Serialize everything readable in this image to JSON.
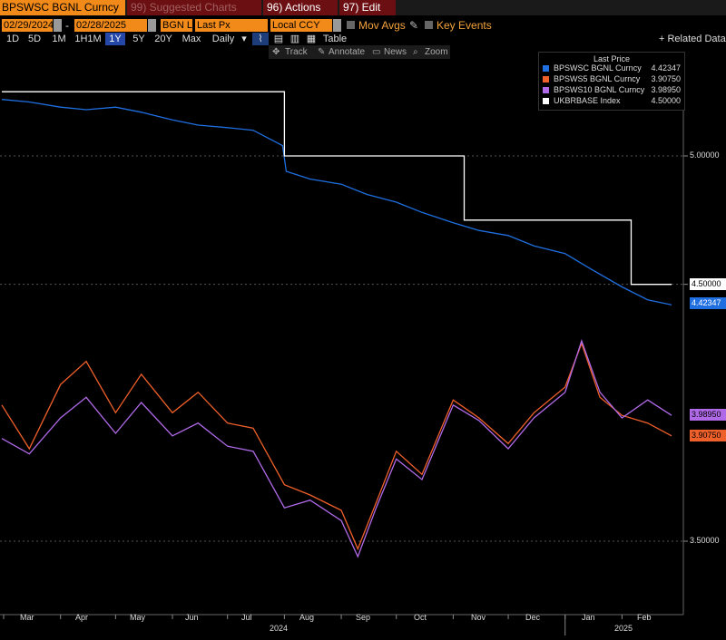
{
  "toolbar": {
    "ticker": "BPSWSC BGNL Curncy",
    "suggested_charts": "99) Suggested Charts",
    "actions": "96) Actions",
    "edit": "97) Edit",
    "date_from": "02/29/2024",
    "date_to": "02/28/2025",
    "source": "BGN L",
    "price_field": "Last Px",
    "currency": "Local CCY",
    "mov_avgs": "Mov Avgs",
    "key_events": "Key Events",
    "periods": [
      "1D",
      "5D",
      "1M",
      "1H1M",
      "1Y",
      "5Y",
      "20Y",
      "Max"
    ],
    "selected_period": "1Y",
    "frequency": "Daily",
    "table": "Table",
    "related": "+ Related Data",
    "track": "Track",
    "annotate": "Annotate",
    "news": "News",
    "zoom": "Zoom"
  },
  "chart_data": {
    "type": "line",
    "yticks": [
      "5.00000",
      "4.50000",
      "3.50000"
    ],
    "xticks": [
      "Mar",
      "Apr",
      "May",
      "Jun",
      "Jul",
      "Aug",
      "Sep",
      "Oct",
      "Nov",
      "Dec",
      "Jan",
      "Feb"
    ],
    "year_labels": [
      "2024",
      "2025"
    ],
    "legend_title": "Last Price",
    "legend_position": "top-right",
    "series": [
      {
        "name": "BPSWSC BGNL Curncy",
        "last": "4.42347",
        "color": "#1f6fe0",
        "x": [
          "2024-02-29",
          "2024-03-15",
          "2024-04-01",
          "2024-04-15",
          "2024-05-01",
          "2024-05-15",
          "2024-06-01",
          "2024-06-15",
          "2024-07-01",
          "2024-07-15",
          "2024-07-31",
          "2024-08-02",
          "2024-08-15",
          "2024-09-01",
          "2024-09-15",
          "2024-10-01",
          "2024-10-15",
          "2024-11-01",
          "2024-11-15",
          "2024-12-01",
          "2024-12-15",
          "2025-01-01",
          "2025-01-15",
          "2025-02-01",
          "2025-02-15",
          "2025-02-28"
        ],
        "y": [
          5.22,
          5.21,
          5.19,
          5.18,
          5.19,
          5.17,
          5.14,
          5.12,
          5.11,
          5.1,
          5.04,
          4.94,
          4.91,
          4.89,
          4.85,
          4.82,
          4.78,
          4.74,
          4.71,
          4.69,
          4.65,
          4.62,
          4.56,
          4.49,
          4.44,
          4.42
        ]
      },
      {
        "name": "BPSWS5 BGNL Curncy",
        "last": "3.90750",
        "color": "#f0602a",
        "x": [
          "2024-02-29",
          "2024-03-15",
          "2024-04-01",
          "2024-04-15",
          "2024-05-01",
          "2024-05-15",
          "2024-06-01",
          "2024-06-15",
          "2024-07-01",
          "2024-07-15",
          "2024-08-01",
          "2024-08-15",
          "2024-09-01",
          "2024-09-10",
          "2024-09-20",
          "2024-10-01",
          "2024-10-15",
          "2024-11-01",
          "2024-11-15",
          "2024-12-01",
          "2024-12-15",
          "2025-01-01",
          "2025-01-10",
          "2025-01-20",
          "2025-02-01",
          "2025-02-15",
          "2025-02-28"
        ],
        "y": [
          4.03,
          3.86,
          4.11,
          4.2,
          4.0,
          4.15,
          4.0,
          4.08,
          3.96,
          3.94,
          3.72,
          3.68,
          3.62,
          3.47,
          3.65,
          3.85,
          3.76,
          4.05,
          3.98,
          3.88,
          4.0,
          4.1,
          4.27,
          4.06,
          3.99,
          3.96,
          3.91
        ]
      },
      {
        "name": "BPSWS10 BGNL Curncy",
        "last": "3.98950",
        "color": "#b06ae8",
        "x": [
          "2024-02-29",
          "2024-03-15",
          "2024-04-01",
          "2024-04-15",
          "2024-05-01",
          "2024-05-15",
          "2024-06-01",
          "2024-06-15",
          "2024-07-01",
          "2024-07-15",
          "2024-08-01",
          "2024-08-15",
          "2024-09-01",
          "2024-09-10",
          "2024-09-20",
          "2024-10-01",
          "2024-10-15",
          "2024-11-01",
          "2024-11-15",
          "2024-12-01",
          "2024-12-15",
          "2025-01-01",
          "2025-01-10",
          "2025-01-20",
          "2025-02-01",
          "2025-02-15",
          "2025-02-28"
        ],
        "y": [
          3.9,
          3.84,
          3.98,
          4.06,
          3.92,
          4.04,
          3.91,
          3.96,
          3.87,
          3.85,
          3.63,
          3.66,
          3.58,
          3.44,
          3.63,
          3.82,
          3.74,
          4.03,
          3.97,
          3.86,
          3.98,
          4.08,
          4.28,
          4.08,
          3.98,
          4.05,
          3.99
        ]
      },
      {
        "name": "UKBRBASE Index",
        "last": "4.50000",
        "color": "#ffffff",
        "x": [
          "2024-02-29",
          "2024-08-01",
          "2024-08-01",
          "2024-09-19",
          "2024-09-19",
          "2024-11-07",
          "2024-11-07",
          "2025-02-06",
          "2025-02-06",
          "2025-02-28"
        ],
        "y": [
          5.25,
          5.25,
          5.0,
          5.0,
          5.0,
          5.0,
          4.75,
          4.75,
          4.5,
          4.5
        ]
      }
    ]
  }
}
